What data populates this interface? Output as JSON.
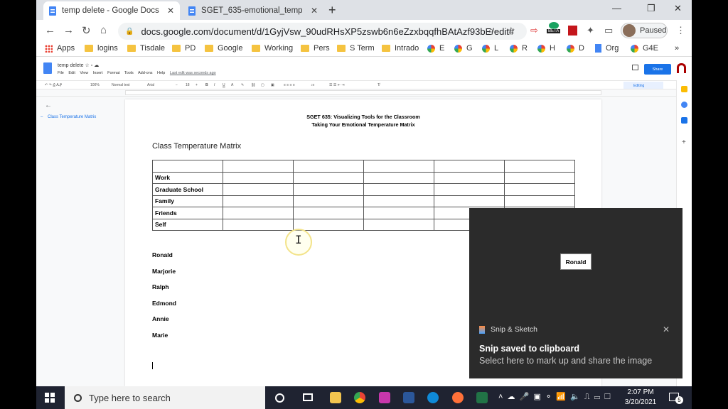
{
  "browser": {
    "tabs": [
      {
        "title": "temp delete - Google Docs",
        "active": true
      },
      {
        "title": "SGET_635-emotional_temperatur",
        "active": false
      }
    ],
    "url": "docs.google.com/document/d/1GyjVsw_90udRHsXP5zswb6n6eZzxbqqfhBAtAzf93bE/edit#",
    "profile_label": "Paused",
    "beta_badge": "BETA",
    "bookmarks": [
      "Apps",
      "logins",
      "Tisdale",
      "PD",
      "Google",
      "Working",
      "Pers",
      "S Term",
      "Intrado",
      "E",
      "G",
      "L",
      "R",
      "H",
      "D",
      "Org",
      "G4E"
    ],
    "more_bookmarks": "»"
  },
  "docs": {
    "title": "temp delete",
    "menu": [
      "File",
      "Edit",
      "View",
      "Insert",
      "Format",
      "Tools",
      "Add-ons",
      "Help"
    ],
    "last_edit": "Last edit was seconds ago",
    "share_label": "Share",
    "toolbar": {
      "zoom": "100%",
      "style": "Normal text",
      "font": "Arial",
      "size": "18",
      "mode": "Editing"
    },
    "outline_item": "Class Temperature Matrix"
  },
  "document": {
    "heading1": "SGET 635: Visualizing Tools for the Classroom",
    "heading2": "Taking Your Emotional Temperature Matrix",
    "matrix_title": "Class Temperature Matrix",
    "table_rows": [
      "",
      "Work",
      "Graduate School",
      "Family",
      "Friends",
      "Self"
    ],
    "students": [
      "Ronald",
      "Marjorie",
      "Ralph",
      "Edmond",
      "Annie",
      "Marie"
    ]
  },
  "snip": {
    "preview_text": "Ronald",
    "app_name": "Snip & Sketch",
    "title": "Snip saved to clipboard",
    "subtitle": "Select here to mark up and share the image"
  },
  "taskbar": {
    "search_placeholder": "Type here to search",
    "time": "2:07 PM",
    "date": "3/20/2021",
    "notification_count": "5"
  }
}
